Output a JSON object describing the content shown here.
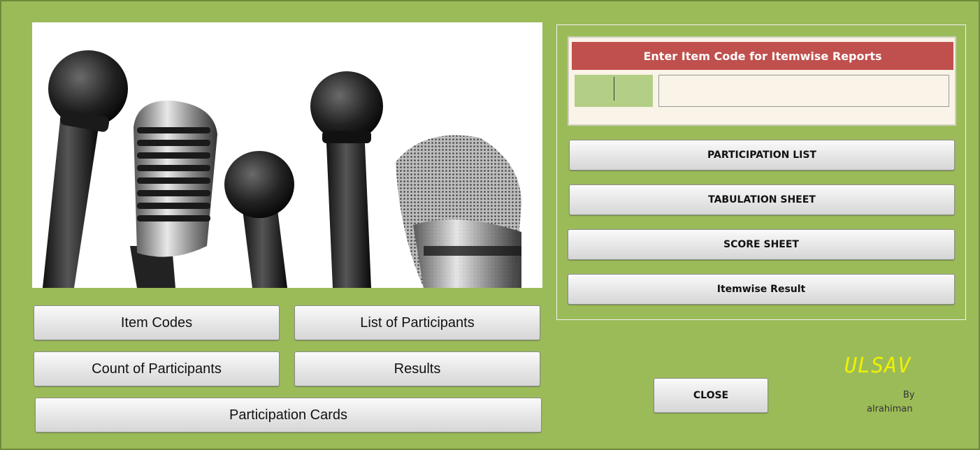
{
  "report_panel": {
    "header": "Enter Item Code for Itemwise Reports",
    "item_code_value": "",
    "buttons": {
      "participation_list": "PARTICIPATION LIST",
      "tabulation_sheet": "TABULATION SHEET",
      "score_sheet": "SCORE SHEET",
      "itemwise_result": "Itemwise Result"
    }
  },
  "main_buttons": {
    "item_codes": "Item Codes",
    "list_of_participants": "List of Participants",
    "count_of_participants": "Count of Participants",
    "results": "Results",
    "participation_cards": "Participation Cards"
  },
  "close_label": "CLOSE",
  "brand": {
    "name": "ULSAV",
    "by": "By",
    "author": "alrahiman"
  },
  "colors": {
    "form_background": "#9bbb59",
    "header_red": "#c0504d",
    "brand_yellow": "#f0f000"
  }
}
